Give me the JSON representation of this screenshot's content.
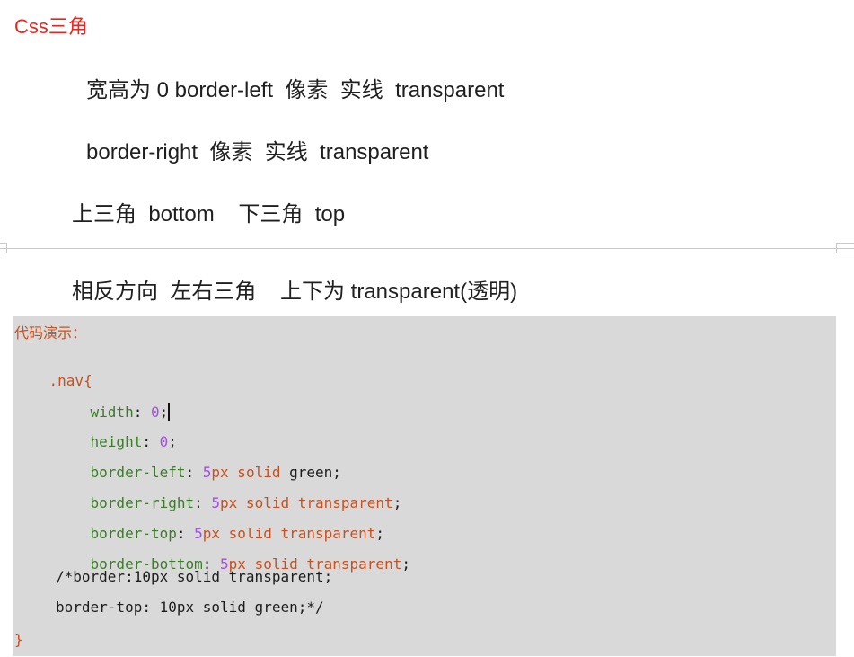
{
  "doc": {
    "title": "Css三角",
    "line1": "宽高为 0 border-left  像素  实线  transparent",
    "line2": "border-right  像素  实线  transparent",
    "line3": "上三角  bottom    下三角  top",
    "line4": "相反方向  左右三角    上下为 transparent(透明)"
  },
  "code": {
    "label": "代码演示：",
    "selector": ".nav",
    "open_brace": "{",
    "close_brace": "}",
    "lines": [
      {
        "prop": "width",
        "colon": ": ",
        "num": "0",
        "unit": "",
        "style": "",
        "color": "",
        "semi": ";"
      },
      {
        "prop": "height",
        "colon": ": ",
        "num": "0",
        "unit": "",
        "style": "",
        "color": "",
        "semi": ";"
      },
      {
        "prop": "border-left",
        "colon": ": ",
        "num": "5",
        "unit": "px",
        "style": " solid",
        "color": " green",
        "semi": ";"
      },
      {
        "prop": "border-right",
        "colon": ": ",
        "num": "5",
        "unit": "px",
        "style": " solid",
        "color": " transparent",
        "semi": ";"
      },
      {
        "prop": "border-top",
        "colon": ": ",
        "num": "5",
        "unit": "px",
        "style": " solid",
        "color": " transparent",
        "semi": ";"
      },
      {
        "prop": "border-bottom",
        "colon": ": ",
        "num": "5",
        "unit": "px",
        "style": " solid",
        "color": " transparent",
        "semi": ";"
      }
    ],
    "comment1": "/*border:10px solid transparent;",
    "comment2": "border-top: 10px solid green;*/"
  }
}
